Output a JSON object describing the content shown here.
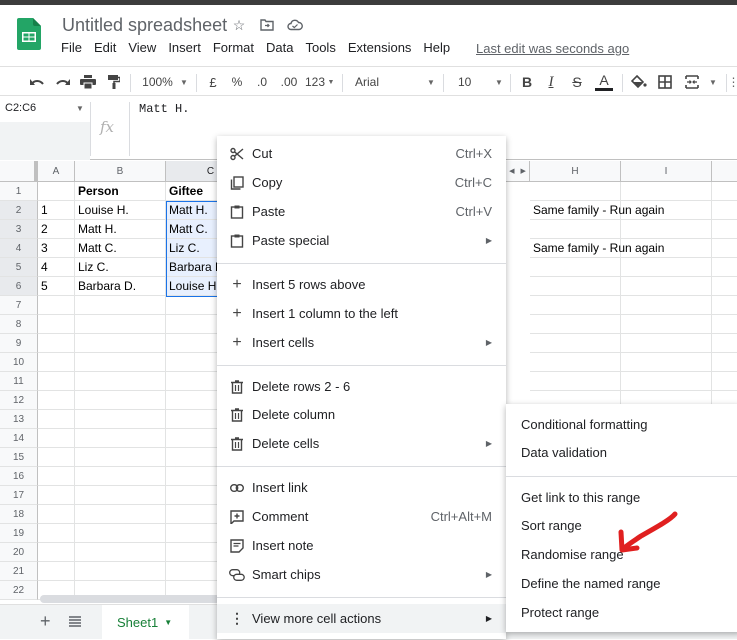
{
  "app": {
    "title": "Untitled spreadsheet",
    "last_edit": "Last edit was seconds ago"
  },
  "menu": [
    "File",
    "Edit",
    "View",
    "Insert",
    "Format",
    "Data",
    "Tools",
    "Extensions",
    "Help"
  ],
  "toolbar": {
    "zoom": "100%",
    "currency": "£",
    "percent": "%",
    "dec_decrease": ".0",
    "dec_increase": ".00",
    "number_format": "123",
    "font": "Arial",
    "font_size": "10",
    "bold": "B",
    "italic": "I",
    "strike": "S",
    "text_color": "A"
  },
  "formula_bar": {
    "name_box": "C2:C6",
    "fx": "fx",
    "value": "Matt H."
  },
  "grid": {
    "columns": [
      "A",
      "B",
      "C",
      "H",
      "I"
    ],
    "rows": [
      "1",
      "2",
      "3",
      "4",
      "5",
      "6",
      "7",
      "8",
      "9",
      "10",
      "11",
      "12",
      "13",
      "14",
      "15",
      "16",
      "17",
      "18",
      "19",
      "20",
      "21",
      "22"
    ],
    "cells": {
      "B1": "Person",
      "C1": "Giftee",
      "A2": "1",
      "B2": "Louise H.",
      "C2": "Matt H.",
      "H2": "Same family - Run again",
      "A3": "2",
      "B3": "Matt H.",
      "C3": "Matt C.",
      "A4": "3",
      "B4": "Matt C.",
      "C4": "Liz C.",
      "H4": "Same family - Run again",
      "A5": "4",
      "B5": "Liz C.",
      "C5": "Barbara D.",
      "A6": "5",
      "B6": "Barbara D.",
      "C6": "Louise H."
    }
  },
  "sheets": {
    "active": "Sheet1"
  },
  "context_menu": {
    "items": [
      {
        "label": "Cut",
        "shortcut": "Ctrl+X",
        "icon": "scissors-icon"
      },
      {
        "label": "Copy",
        "shortcut": "Ctrl+C",
        "icon": "copy-icon"
      },
      {
        "label": "Paste",
        "shortcut": "Ctrl+V",
        "icon": "clipboard-icon"
      },
      {
        "label": "Paste special",
        "submenu": true,
        "icon": "clipboard-icon"
      },
      {
        "label": "Insert 5 rows above",
        "icon": "plus-icon"
      },
      {
        "label": "Insert 1 column to the left",
        "icon": "plus-icon"
      },
      {
        "label": "Insert cells",
        "submenu": true,
        "icon": "plus-icon"
      },
      {
        "label": "Delete rows 2 - 6",
        "icon": "trash-icon"
      },
      {
        "label": "Delete column",
        "icon": "trash-icon"
      },
      {
        "label": "Delete cells",
        "submenu": true,
        "icon": "trash-icon"
      },
      {
        "label": "Insert link",
        "icon": "link-icon"
      },
      {
        "label": "Comment",
        "shortcut": "Ctrl+Alt+M",
        "icon": "comment-icon"
      },
      {
        "label": "Insert note",
        "icon": "note-icon"
      },
      {
        "label": "Smart chips",
        "submenu": true,
        "icon": "smart-chips-icon"
      },
      {
        "label": "View more cell actions",
        "submenu": true,
        "icon": "more-vert-icon"
      }
    ]
  },
  "submenu": {
    "items": [
      "Conditional formatting",
      "Data validation",
      "Get link to this range",
      "Sort range",
      "Randomise range",
      "Define the named range",
      "Protect range"
    ]
  },
  "colors": {
    "brand_green": "#0f9d58",
    "selection_blue": "#1a73e8",
    "annotation_red": "#e02020"
  }
}
